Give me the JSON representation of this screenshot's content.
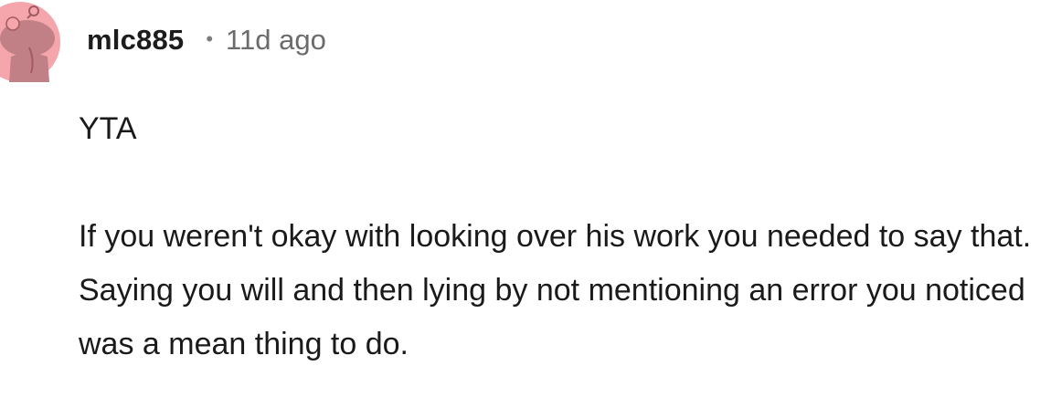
{
  "comment": {
    "author": "mlc885",
    "separator": "•",
    "time": "11d ago",
    "paragraphs": [
      "YTA",
      "If you weren't okay with looking over his work you needed to say that. Saying you will and then lying by not mentioning an error you noticed was a mean thing to do."
    ]
  },
  "colors": {
    "avatar_bg": "#f5a5ac",
    "avatar_figure": "#c17f86",
    "text": "#1a1a1b",
    "meta": "#6b6b6b"
  },
  "icons": {
    "avatar": "reddit-snoo-avatar-icon"
  }
}
